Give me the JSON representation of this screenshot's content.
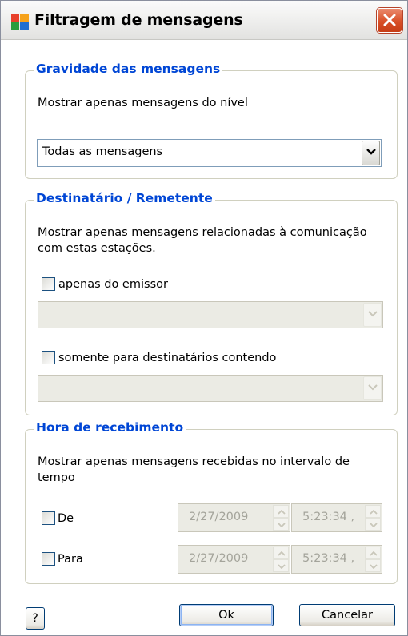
{
  "window": {
    "title": "Filtragem de mensagens",
    "icon": "avg-app-icon",
    "close_icon": "close-icon"
  },
  "severity": {
    "legend": "Gravidade das mensagens",
    "description": "Mostrar apenas mensagens do nível",
    "level_value": "Todas as mensagens"
  },
  "recipient": {
    "legend": "Destinatário / Remetente",
    "description_line1": "Mostrar apenas mensagens relacionadas à comunicação",
    "description_line2": "com estas estações.",
    "sender_label": "apenas do emissor",
    "sender_checked": false,
    "sender_value": "",
    "recipients_label": "somente para destinatários contendo",
    "recipients_checked": false,
    "recipients_value": ""
  },
  "time": {
    "legend": "Hora de recebimento",
    "description_line1": "Mostrar apenas mensagens recebidas no intervalo de",
    "description_line2": "tempo",
    "from_label": "De",
    "from_checked": false,
    "from_date": "2/27/2009",
    "from_time": "5:23:34 ,",
    "to_label": "Para",
    "to_checked": false,
    "to_date": "2/27/2009",
    "to_time": "5:23:34 ,"
  },
  "buttons": {
    "help_label": "?",
    "ok_label": "Ok",
    "cancel_label": "Cancelar"
  },
  "colors": {
    "legend": "#0046d5",
    "close_button": "#d84f27",
    "disabled_text": "#a4a49b"
  }
}
